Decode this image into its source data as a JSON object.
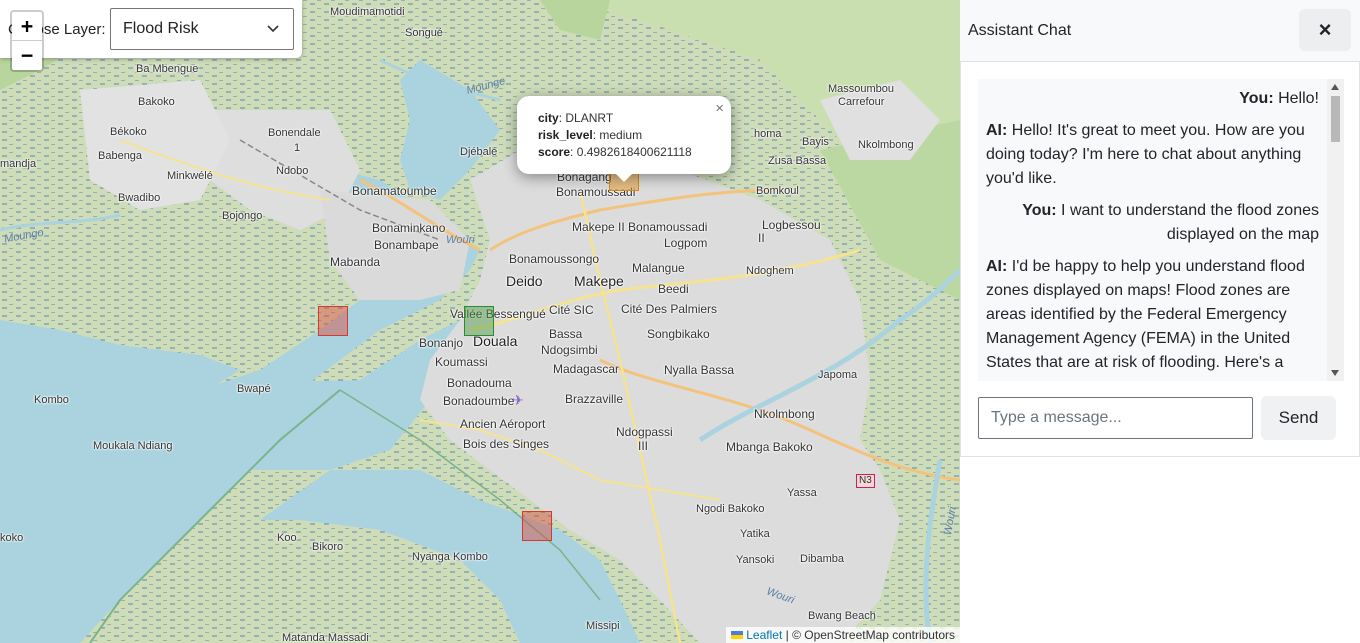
{
  "map": {
    "layer_control": {
      "label": "Choose Layer:",
      "selected": "Flood Risk"
    },
    "zoom": {
      "in": "+",
      "out": "−"
    },
    "popup": {
      "city_key": "city",
      "city": "DLANRT",
      "risk_key": "risk_level",
      "risk_level": "medium",
      "score_key": "score",
      "score": "0.4982618400621118",
      "close": "×"
    },
    "attribution": {
      "leaflet": "Leaflet",
      "rest": " | © OpenStreetMap contributors"
    },
    "risk_colors": {
      "high": "#d63a2f",
      "medium": "#d68a1a",
      "low": "#2f8a2a"
    },
    "places": {
      "moudimamotidi": "Moudimamotidi",
      "songue": "Songué",
      "ba_mbengue": "Ba Mbengue",
      "bakoko": "Bakoko",
      "bonendale": "Bonendale",
      "bonendale1": "1",
      "bekoko": "Békoko",
      "babenga": "Babenga",
      "minkwele": "Minkwélé",
      "ndobo": "Ndobo",
      "djebale": "Djébalé",
      "mandja": "mandja",
      "bwadibo": "Bwadibo",
      "bojongo": "Bojongo",
      "bonamatoumbe": "Bonamatoumbe",
      "bonaminkano": "Bonaminkano",
      "bonambape": "Bonambape",
      "wouri1": "Wouri",
      "mabanda": "Mabanda",
      "bonagang": "Bonagang",
      "bonamoussadi": "Bonamoussadi",
      "makepe2": "Makepe II Bonamoussadi",
      "logpom": "Logpom",
      "logbessou": "Logbessou",
      "logbessou2": "II",
      "massoumbou": "Massoumbou",
      "carrefour": "Carrefour",
      "bayis": "Bayis",
      "nkolmbong1": "Nkolmbong",
      "zusa_bassa": "Zusa Bassa",
      "bomkoul": "Bomkoul",
      "ndoghem": "Ndoghem",
      "bonamoussongo": "Bonamoussongo",
      "deido": "Deido",
      "makepe": "Makepe",
      "malangue": "Malangue",
      "beedi": "Beedi",
      "vallee": "Vallée Bessengué",
      "cite_sic": "Cité SIC",
      "cite_palmiers": "Cité Des Palmiers",
      "bonanjo": "Bonanjo",
      "douala": "Douala",
      "bassa": "Bassa",
      "songbikako": "Songbikako",
      "koumassi": "Koumassi",
      "ndogsimbi": "Ndogsimbi",
      "madagascar": "Madagascar",
      "nyalla_bassa": "Nyalla Bassa",
      "japoma": "Japoma",
      "bonadouma": "Bonadouma",
      "bonadoumbe": "Bonadoumbe",
      "brazzaville": "Brazzaville",
      "ancien_aeroport": "Ancien Aéroport",
      "bois_des_singes": "Bois des Singes",
      "ndogpassi": "Ndogpassi",
      "ndogpassi3": "III",
      "nkolmbong2": "Nkolmbong",
      "mbanga_bakoko": "Mbanga Bakoko",
      "yassa": "Yassa",
      "ngodi_bakoko": "Ngodi Bakoko",
      "yatika": "Yatika",
      "yansoki": "Yansoki",
      "dibamba": "Dibamba",
      "bwange_beach": "Bwang Beach",
      "missipi": "Missipi",
      "kombo": "Kombo",
      "bwape": "Bwapé",
      "moukala_ndiang": "Moukala Ndiang",
      "koo": "Koo",
      "bikoro": "Bikoro",
      "nyanga_kombo": "Nyanga Kombo",
      "matanda_massadi": "Matanda Massadi",
      "koko": "koko",
      "mounge": "Mounge",
      "moungo": "Moungo",
      "n3": "N3",
      "wouri2": "Wouri",
      "wouri3": "Wouri",
      "homa": "homa"
    }
  },
  "chat": {
    "title": "Assistant Chat",
    "close": "×",
    "messages": [
      {
        "role": "user",
        "who": "You:",
        "text": "Hello!"
      },
      {
        "role": "ai",
        "who": "AI:",
        "text": "Hello! It's great to meet you. How are you doing today? I'm here to chat about anything you'd like."
      },
      {
        "role": "user",
        "who": "You:",
        "text": "I want to understand the flood zones displayed on the map"
      },
      {
        "role": "ai",
        "who": "AI:",
        "text": "I'd be happy to help you understand flood zones displayed on maps! Flood zones are areas identified by the Federal Emergency Management Agency (FEMA) in the United States that are at risk of flooding. Here's a"
      }
    ],
    "input_placeholder": "Type a message...",
    "send_label": "Send"
  }
}
